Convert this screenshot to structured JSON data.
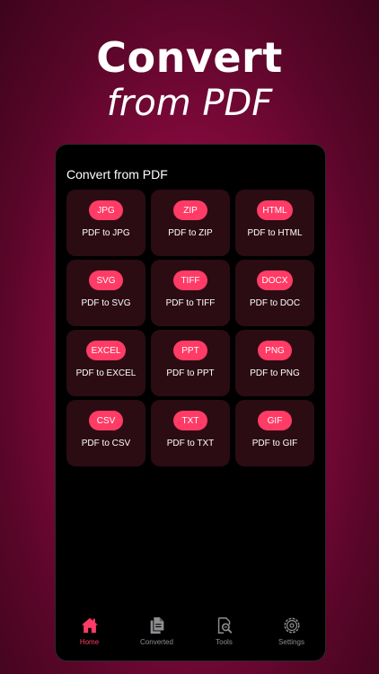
{
  "hero": {
    "title": "Convert",
    "subtitle": "from PDF"
  },
  "section": {
    "title": "Convert from PDF"
  },
  "cards": [
    {
      "badge": "JPG",
      "label": "PDF to JPG"
    },
    {
      "badge": "ZIP",
      "label": "PDF to ZIP"
    },
    {
      "badge": "HTML",
      "label": "PDF to HTML"
    },
    {
      "badge": "SVG",
      "label": "PDF to SVG"
    },
    {
      "badge": "TIFF",
      "label": "PDF to TIFF"
    },
    {
      "badge": "DOCX",
      "label": "PDF to DOC"
    },
    {
      "badge": "EXCEL",
      "label": "PDF to EXCEL"
    },
    {
      "badge": "PPT",
      "label": "PDF to PPT"
    },
    {
      "badge": "PNG",
      "label": "PDF to PNG"
    },
    {
      "badge": "CSV",
      "label": "PDF to CSV"
    },
    {
      "badge": "TXT",
      "label": "PDF to TXT"
    },
    {
      "badge": "GIF",
      "label": "PDF to GIF"
    }
  ],
  "tabs": [
    {
      "label": "Home",
      "icon": "home-icon",
      "active": true
    },
    {
      "label": "Converted",
      "icon": "documents-icon",
      "active": false
    },
    {
      "label": "Tools",
      "icon": "search-document-icon",
      "active": false
    },
    {
      "label": "Settings",
      "icon": "gear-icon",
      "active": false
    }
  ],
  "colors": {
    "accent": "#ff3b66",
    "card": "#2b0c13",
    "inactive": "#8e8e93"
  }
}
